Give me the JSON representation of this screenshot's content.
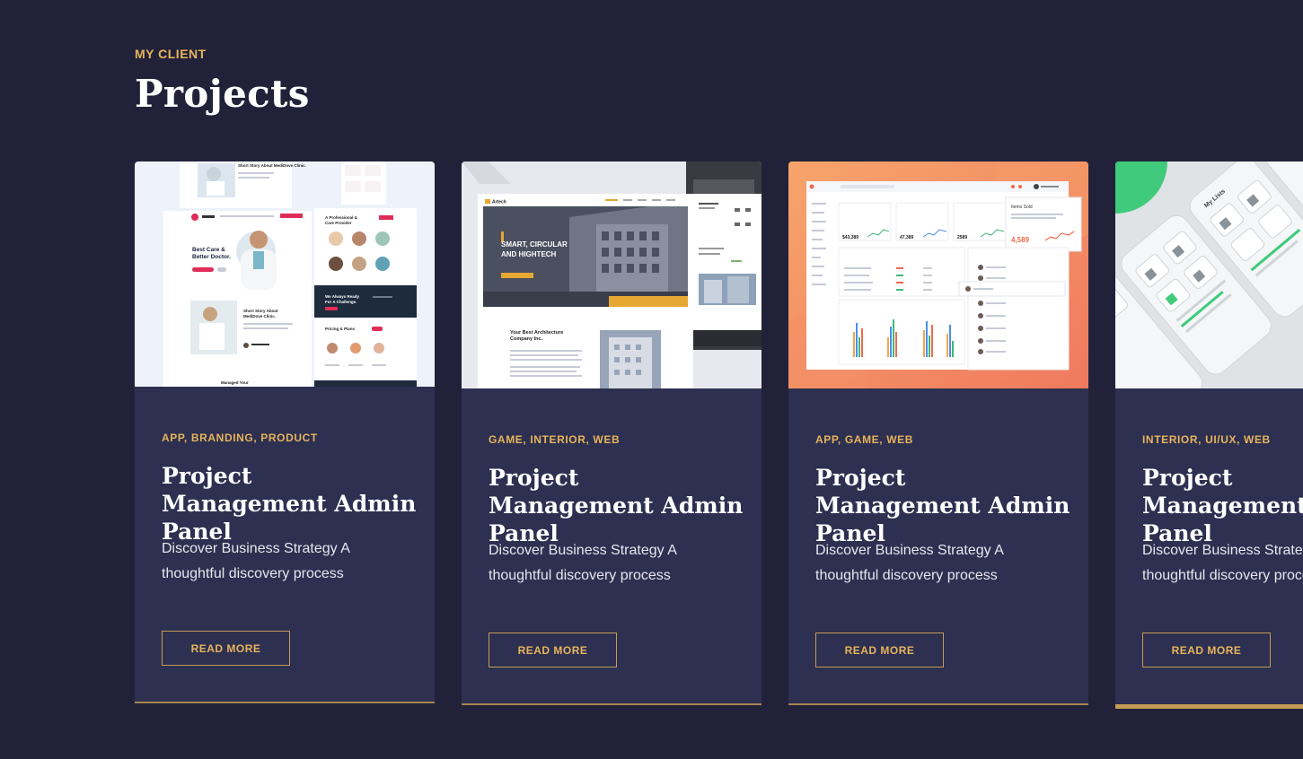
{
  "section": {
    "eyebrow": "MY CLIENT",
    "title": "Projects"
  },
  "cards": [
    {
      "tags": [
        "APP,",
        "BRANDING,",
        "PRODUCT"
      ],
      "title": "Project Management Admin Panel",
      "description": "Discover Business Strategy A thoughtful discovery process",
      "button": "READ MORE",
      "thumbnail": {
        "heading1": "Short Story About MediDove Clinic.",
        "heading2": "Best Care & Better Doctor.",
        "heading3": "A Professional & Care Provider",
        "heading4": "We Always Ready For A Challenge.",
        "heading5": "Pricing & Plans",
        "heading6": "Managed Your"
      }
    },
    {
      "tags": [
        "GAME,",
        "INTERIOR,",
        "WEB"
      ],
      "title": "Project Management Admin Panel",
      "description": "Discover Business Strategy A thoughtful discovery process",
      "button": "READ MORE",
      "thumbnail": {
        "brand": "Artech",
        "hero": "SMART, CIRCULAR AND HIGHTECH",
        "about": "Your Best Architecture Company Inc."
      }
    },
    {
      "tags": [
        "APP,",
        "GAME,",
        "WEB"
      ],
      "title": "Project Management Admin Panel",
      "description": "Discover Business Strategy A thoughtful discovery process",
      "button": "READ MORE",
      "thumbnail": {
        "card1": "$43,389",
        "card2": "47,389",
        "card3": "2589",
        "items_sold_label": "Items Sold",
        "items_sold_value": "4,589"
      }
    },
    {
      "tags": [
        "INTERIOR,",
        "UI/UX,",
        "WEB"
      ],
      "title": "Project Management Admin Panel",
      "description": "Discover Business Strategy A thoughtful discovery process",
      "button": "READ MORE",
      "thumbnail": {
        "label": "My Lists"
      }
    }
  ]
}
